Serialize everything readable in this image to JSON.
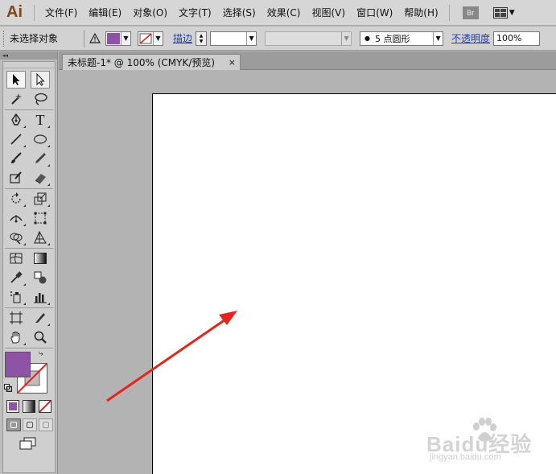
{
  "app": {
    "logo": "Ai"
  },
  "menu": {
    "items": [
      "文件(F)",
      "编辑(E)",
      "对象(O)",
      "文字(T)",
      "选择(S)",
      "效果(C)",
      "视图(V)",
      "窗口(W)",
      "帮助(H)"
    ],
    "bridge_label": "Br"
  },
  "control_bar": {
    "selection_status": "未选择对象",
    "fill_color": "#8e52a6",
    "stroke_label": "描边",
    "brush_value": "5 点圆形",
    "opacity_label": "不透明度",
    "opacity_value": "100%"
  },
  "panel": {
    "collapse_glyph": "◂◂"
  },
  "document": {
    "tab_title": "未标题-1* @ 100% (CMYK/预览)",
    "close_glyph": "×"
  },
  "toolbox": {
    "fill_color": "#8e52a6",
    "stroke_color": "none"
  },
  "watermark": {
    "brand": "Baidu经验",
    "url": "jingyan.baidu.com"
  },
  "colors": {
    "annotation_arrow": "#e8231c"
  }
}
